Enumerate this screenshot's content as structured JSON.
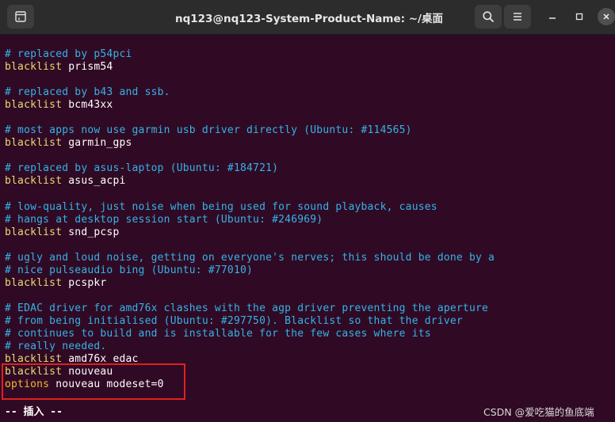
{
  "window": {
    "title": "nq123@nq123-System-Product-Name: ~/桌面",
    "icons": {
      "new_tab": "new-tab-icon",
      "search": "search-icon",
      "menu": "hamburger-menu-icon",
      "minimize": "minimize-icon",
      "maximize": "maximize-icon",
      "close": "close-icon"
    }
  },
  "terminal": {
    "lines": [
      {
        "type": "comment",
        "text": "# replaced by p54pci"
      },
      {
        "type": "blacklist",
        "kw": "blacklist",
        "rest": " prism54"
      },
      {
        "type": "blank",
        "text": ""
      },
      {
        "type": "comment",
        "text": "# replaced by b43 and ssb."
      },
      {
        "type": "blacklist",
        "kw": "blacklist",
        "rest": " bcm43xx"
      },
      {
        "type": "blank",
        "text": ""
      },
      {
        "type": "comment",
        "text": "# most apps now use garmin usb driver directly (Ubuntu: #114565)"
      },
      {
        "type": "blacklist",
        "kw": "blacklist",
        "rest": " garmin_gps"
      },
      {
        "type": "blank",
        "text": ""
      },
      {
        "type": "comment",
        "text": "# replaced by asus-laptop (Ubuntu: #184721)"
      },
      {
        "type": "blacklist",
        "kw": "blacklist",
        "rest": " asus_acpi"
      },
      {
        "type": "blank",
        "text": ""
      },
      {
        "type": "comment",
        "text": "# low-quality, just noise when being used for sound playback, causes"
      },
      {
        "type": "comment",
        "text": "# hangs at desktop session start (Ubuntu: #246969)"
      },
      {
        "type": "blacklist",
        "kw": "blacklist",
        "rest": " snd_pcsp"
      },
      {
        "type": "blank",
        "text": ""
      },
      {
        "type": "comment",
        "text": "# ugly and loud noise, getting on everyone's nerves; this should be done by a"
      },
      {
        "type": "comment",
        "text": "# nice pulseaudio bing (Ubuntu: #77010)"
      },
      {
        "type": "blacklist",
        "kw": "blacklist",
        "rest": " pcspkr"
      },
      {
        "type": "blank",
        "text": ""
      },
      {
        "type": "comment",
        "text": "# EDAC driver for amd76x clashes with the agp driver preventing the aperture"
      },
      {
        "type": "comment",
        "text": "# from being initialised (Ubuntu: #297750). Blacklist so that the driver"
      },
      {
        "type": "comment",
        "text": "# continues to build and is installable for the few cases where its"
      },
      {
        "type": "comment",
        "text": "# really needed."
      },
      {
        "type": "blacklist",
        "kw": "blacklist",
        "rest": " amd76x_edac"
      },
      {
        "type": "blacklist",
        "kw": "blacklist",
        "rest": " nouveau"
      },
      {
        "type": "options",
        "kw": "options",
        "rest": " nouveau modeset=0"
      }
    ],
    "status": "-- 插入 --",
    "watermark": "CSDN @爱吃猫的鱼底端"
  },
  "colors": {
    "background": "#300a24",
    "comment": "#34b3e8",
    "keyword": "#e6db74",
    "options_keyword": "#f5b82e",
    "highlight_box": "#e02020"
  }
}
